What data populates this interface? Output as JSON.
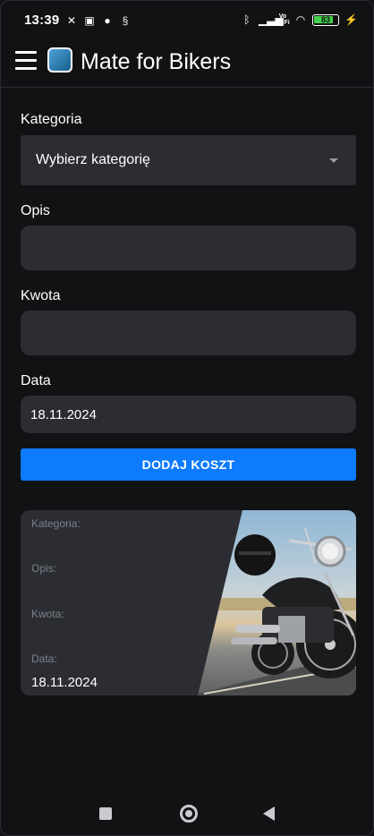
{
  "status_bar": {
    "time": "13:39",
    "left_icons": [
      "notification-off-icon",
      "nfc-icon",
      "app-a-icon",
      "alert-icon"
    ],
    "right_icons": [
      "bluetooth-icon",
      "signal-icon",
      "vowifi-icon",
      "wifi-icon"
    ],
    "vowifi_label": "Vo\nWiFi",
    "battery": "83",
    "battery_level": 0.83,
    "battery_color": "#42d14a"
  },
  "app_bar": {
    "title": "Mate for Bikers",
    "menu_icon": "hamburger-menu-icon",
    "logo_icon": "app-logo-icon"
  },
  "form": {
    "category_label": "Kategoria",
    "category_value": "Wybierz kategorię",
    "description_label": "Opis",
    "description_value": "",
    "amount_label": "Kwota",
    "amount_value": "",
    "date_label": "Data",
    "date_value": "18.11.2024",
    "submit_label": "DODAJ KOSZT"
  },
  "card": {
    "category_label": "Kategoria:",
    "description_label": "Opis:",
    "amount_label": "Kwota:",
    "date_label": "Data:",
    "date_value": "18.11.2024",
    "image_icon": "motorcycle-image"
  },
  "nav_bar": {
    "icons": [
      "recent-apps-icon",
      "home-icon",
      "back-icon"
    ]
  },
  "colors": {
    "background": "#111214",
    "field": "#2b2d33",
    "accent": "#0d7bfd"
  }
}
